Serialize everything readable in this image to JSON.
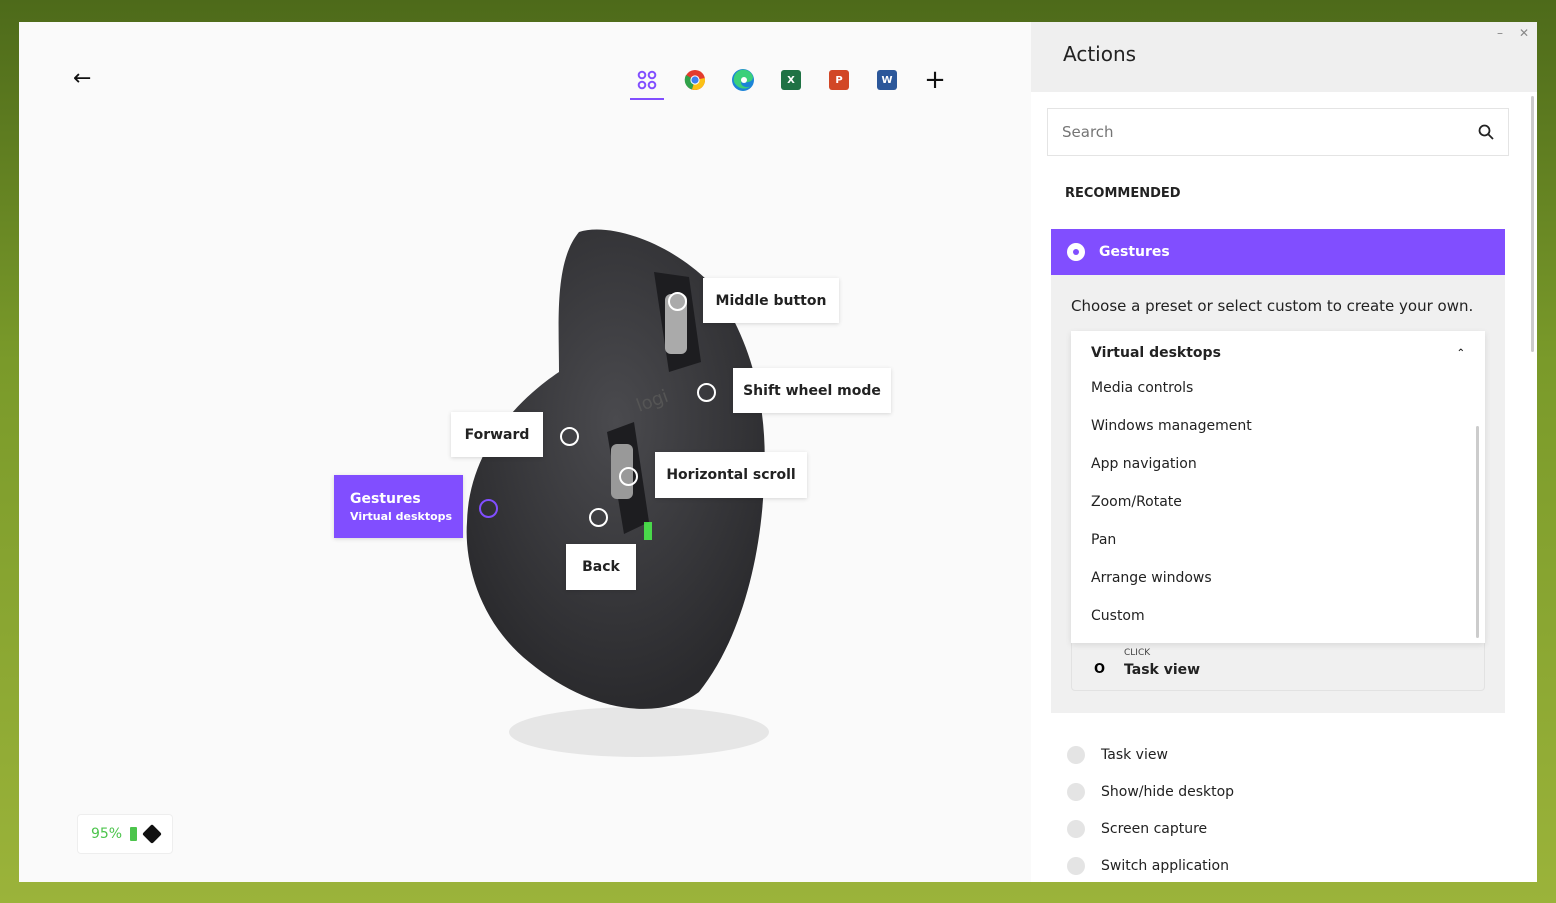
{
  "header": {
    "back_icon": "arrow-left-icon"
  },
  "apps": [
    {
      "name": "all-applications",
      "icon": "grid-icon",
      "selected": true
    },
    {
      "name": "chrome",
      "icon": "chrome-icon"
    },
    {
      "name": "edge",
      "icon": "edge-icon"
    },
    {
      "name": "excel",
      "icon": "excel-icon",
      "letter": "X"
    },
    {
      "name": "powerpoint",
      "icon": "powerpoint-icon",
      "letter": "P"
    },
    {
      "name": "word",
      "icon": "word-icon",
      "letter": "W"
    },
    {
      "name": "add-application",
      "icon": "plus-icon",
      "label": "+"
    }
  ],
  "device": {
    "logo": "logi",
    "callouts": {
      "middle": "Middle button",
      "shift": "Shift wheel mode",
      "forward": "Forward",
      "hscroll": "Horizontal scroll",
      "back": "Back",
      "gestures": "Gestures",
      "gestures_sub": "Virtual desktops"
    }
  },
  "battery": {
    "percent": "95%",
    "color": "#4cc44c"
  },
  "panel": {
    "title": "Actions",
    "search_placeholder": "Search",
    "recommended": "RECOMMENDED",
    "selected_action": "Gestures",
    "accent": "#814eff",
    "description": "Choose a preset or select custom to create your own.",
    "dropdown": {
      "selected": "Virtual desktops",
      "options": [
        "Media controls",
        "Windows management",
        "App navigation",
        "Zoom/Rotate",
        "Pan",
        "Arrange windows",
        "Custom"
      ]
    },
    "behind": {
      "label_small": "CLICK",
      "label": "Task view"
    },
    "other_actions": [
      "Task view",
      "Show/hide desktop",
      "Screen capture",
      "Switch application"
    ]
  }
}
